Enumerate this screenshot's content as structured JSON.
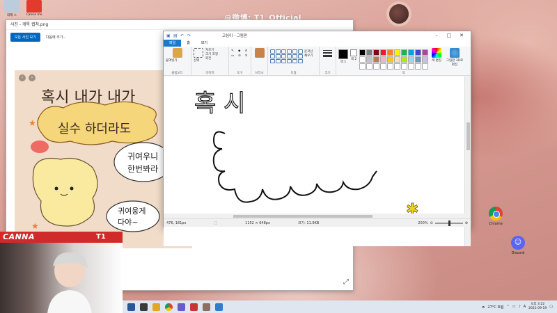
{
  "watermark": "@微博: T1_Official",
  "desktop": {
    "top_apps": [
      {
        "label": "화제 스"
      },
      {
        "label": "Canna mo"
      }
    ],
    "icons": [
      {
        "label": "Chrome"
      },
      {
        "label": "Discord"
      }
    ]
  },
  "photos_window": {
    "title": "사진 - 캐톡 캡쳐.png",
    "view_all_button": "모든 사진 보기",
    "add_to_button": "다음에 추가..."
  },
  "paint_window": {
    "title": "고심이 - 그림판",
    "tabs": [
      "파일",
      "홈",
      "보기"
    ],
    "ribbon": {
      "clipboard": {
        "paste": "붙여넣기",
        "label": "클립보드"
      },
      "image": {
        "select": "선택",
        "crop": "자르기",
        "resize": "크기 조정",
        "rotate": "회전",
        "label": "이미지"
      },
      "tools": {
        "label": "도구"
      },
      "brushes": {
        "label": "브러시"
      },
      "shapes": {
        "outline": "윤곽선",
        "fill": "채우기",
        "label": "도형"
      },
      "size": {
        "label": "크기"
      },
      "colors": {
        "color1": "색 1",
        "color2": "색 2",
        "edit": "색 편집",
        "paint3d": "그림판 3D로 편집",
        "label": "색"
      }
    },
    "status": {
      "cursor": "476, 181px",
      "dimensions": "1152 × 648px",
      "file_size": "크기: 11.9KB",
      "zoom": "200%"
    },
    "canvas_text": "혹 시"
  },
  "webcam": {
    "name": "CANNA",
    "team_logo": "T1"
  },
  "taskbar": {
    "weather": "27°C 흐림",
    "language": "A",
    "time": "오후 3:22",
    "date": "2021-09-19"
  },
  "colors": {
    "accent_red": "#d12a2a",
    "paint_file_tab": "#1979ca",
    "photos_button": "#0067c0"
  }
}
